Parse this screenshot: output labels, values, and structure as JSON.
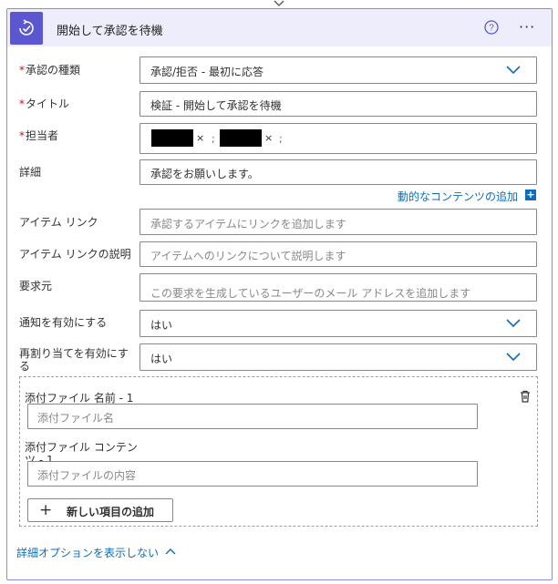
{
  "header": {
    "title": "開始して承認を待機",
    "help_icon": "question-circle-icon",
    "more_icon": "ellipsis-icon",
    "more_label": "···",
    "app_icon": "approval-check-icon"
  },
  "fields": {
    "approval_type": {
      "label": "承認の種類",
      "required": "*",
      "value": "承認/拒否 - 最初に応答"
    },
    "title": {
      "label": "タイトル",
      "required": "*",
      "value": "検証 - 開始して承認を待機"
    },
    "assignee": {
      "label": "担当者",
      "required": "*",
      "token_remove": "×",
      "separator": ";"
    },
    "details": {
      "label": "詳細",
      "value": "承認をお願いします。"
    },
    "add_dynamic": {
      "label": "動的なコンテンツの追加",
      "icon": "plus-square-icon",
      "icon_glyph": "+"
    },
    "item_link": {
      "label": "アイテム リンク",
      "placeholder": "承認するアイテムにリンクを追加します"
    },
    "item_link_desc": {
      "label": "アイテム リンクの説明",
      "placeholder": "アイテムへのリンクについて説明します"
    },
    "requestor": {
      "label": "要求元",
      "placeholder": "この要求を生成しているユーザーのメール アドレスを追加します"
    },
    "enable_notifications": {
      "label": "通知を有効にする",
      "value": "はい"
    },
    "enable_reassignment": {
      "label_line1": "再割り当てを有効にす",
      "label_line2": "る",
      "value": "はい"
    }
  },
  "attachments": {
    "name_label": "添付ファイル 名前 - 1",
    "name_placeholder": "添付ファイル名",
    "content_label_line1": "添付ファイル コンテン",
    "content_label_line2": "ツ - 1",
    "content_placeholder": "添付ファイルの内容",
    "add_item_label": "新しい項目の追加",
    "add_item_icon": "+",
    "delete_icon": "delete-icon"
  },
  "advanced_options": {
    "label": "詳細オプションを表示しない",
    "icon": "chevron-up-icon"
  },
  "colors": {
    "accent": "#5b57d1",
    "header_bg": "#ededfc",
    "link": "#0f6cbd",
    "required": "#c50f1f"
  }
}
